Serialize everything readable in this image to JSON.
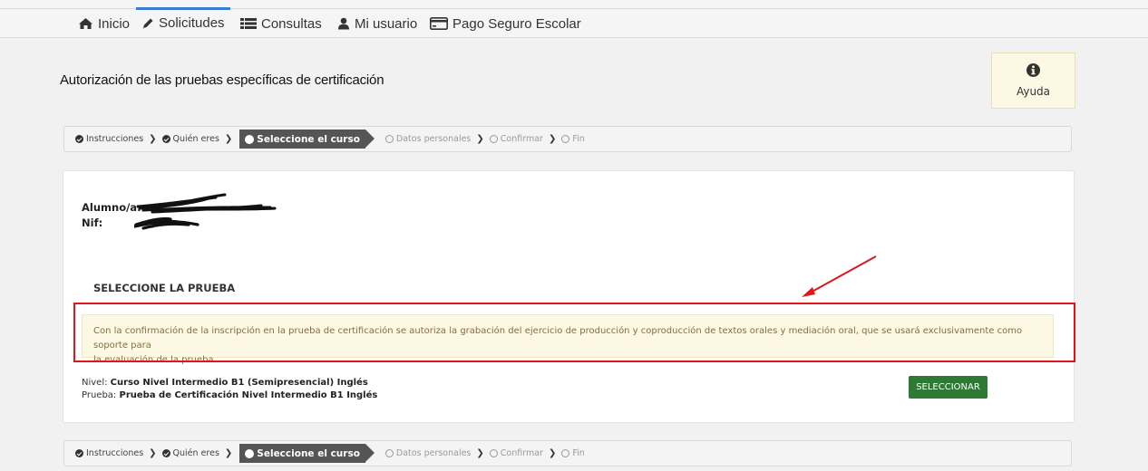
{
  "nav": {
    "items": [
      {
        "label": "Inicio",
        "icon": "home-icon"
      },
      {
        "label": "Solicitudes",
        "icon": "pencil-icon"
      },
      {
        "label": "Consultas",
        "icon": "list-icon"
      },
      {
        "label": "Mi usuario",
        "icon": "user-icon"
      },
      {
        "label": "Pago Seguro Escolar",
        "icon": "credit-card-icon"
      }
    ],
    "active": "Solicitudes"
  },
  "page": {
    "title": "Autorización de las pruebas específicas de certificación",
    "help_label": "Ayuda"
  },
  "steps": [
    {
      "label": "Instrucciones",
      "state": "done"
    },
    {
      "label": "Quién eres",
      "state": "done"
    },
    {
      "label": "Seleccione el curso",
      "state": "current"
    },
    {
      "label": "Datos personales",
      "state": "todo"
    },
    {
      "label": "Confirmar",
      "state": "todo"
    },
    {
      "label": "Fin",
      "state": "todo"
    }
  ],
  "student": {
    "name_label": "Alumno/a:",
    "nif_label": "Nif:"
  },
  "section": {
    "title": "SELECCIONE LA PRUEBA",
    "warning_line1": "Con la confirmación de la inscripción en la prueba de certificación se autoriza la grabación del ejercicio de producción y coproducción de textos orales y mediación oral, que se usará exclusivamente como soporte para",
    "warning_line2": "la evaluación de la prueba."
  },
  "course": {
    "nivel_label": "Nivel:",
    "nivel_value": "Curso Nivel Intermedio B1 (Semipresencial) Inglés",
    "prueba_label": "Prueba:",
    "prueba_value": "Prueba de Certificación Nivel Intermedio B1 Inglés",
    "select_button": "SELECCIONAR"
  },
  "colors": {
    "accent": "#3a7bd5",
    "warning_bg": "#fcf8e3",
    "warning_text": "#8a6d3b",
    "button_green": "#2e7a35",
    "annotation_red": "#e0161a"
  }
}
